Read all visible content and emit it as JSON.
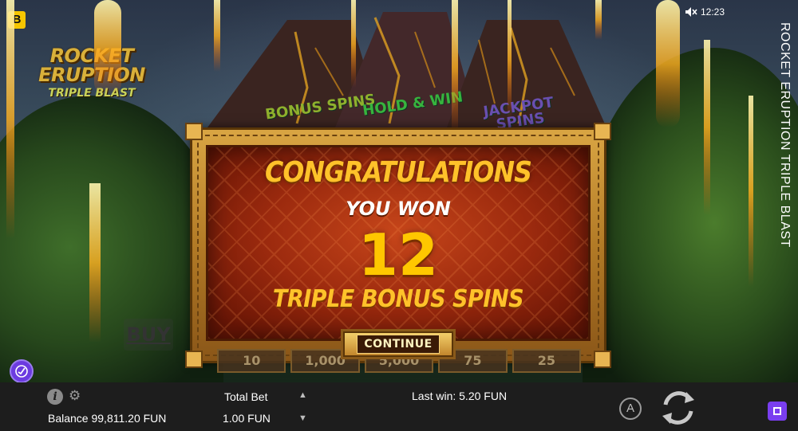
{
  "game": {
    "title": "ROCKET ERUPTION TRIPLE BLAST",
    "logo": {
      "line1": "ROCKET",
      "line2": "ERUPTION",
      "line3": "TRIPLE BLAST"
    },
    "provider_badge": "B",
    "modes": [
      "BONUS SPINS",
      "HOLD & WIN",
      "JACKPOT SPINS"
    ],
    "buy_label": "BUY"
  },
  "status": {
    "sound_icon": "speaker-muted-icon",
    "time": "12:23"
  },
  "dialog": {
    "heading": "CONGRATULATIONS",
    "subheading": "YOU WON",
    "count": "12",
    "prize": "TRIPLE BONUS SPINS",
    "button": "CONTINUE"
  },
  "prize_values": [
    "10",
    "1,000",
    "5,000",
    "75",
    "25"
  ],
  "bottom_bar": {
    "balance": "Balance 99,811.20 FUN",
    "total_bet_label": "Total Bet",
    "total_bet_value": "1.00 FUN",
    "last_win": "Last win: 5.20 FUN",
    "autoplay_label": "A"
  },
  "colors": {
    "accent": "#7a3ef0",
    "gold": "#ffc22a",
    "bar": "#1d1d1d"
  }
}
